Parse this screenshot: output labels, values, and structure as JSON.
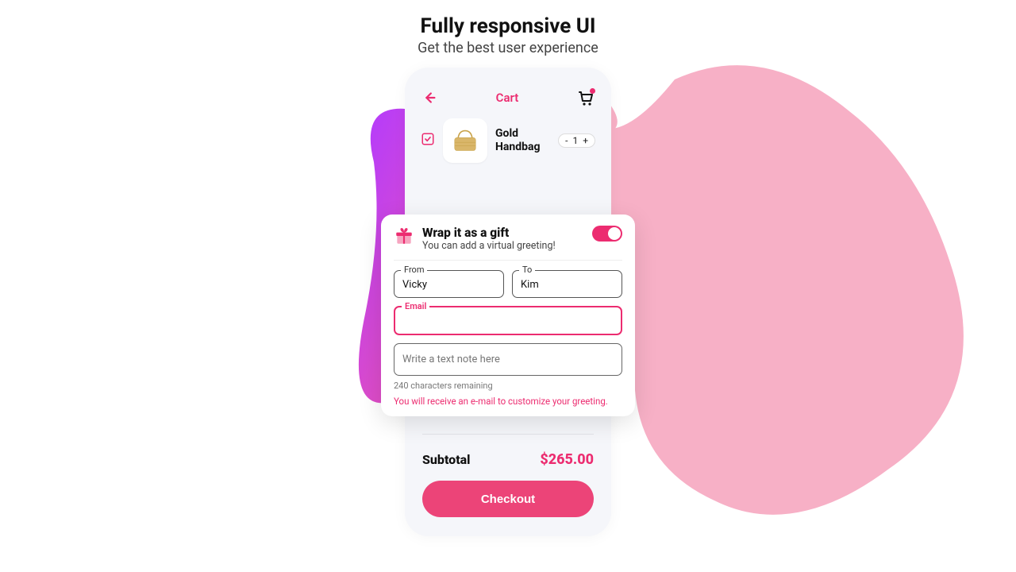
{
  "headline": {
    "title": "Fully responsive UI",
    "subtitle": "Get the best user experience"
  },
  "appbar": {
    "title": "Cart"
  },
  "item": {
    "name_line1": "Gold",
    "name_line2": "Handbag",
    "qty_minus": "-",
    "qty_value": "1",
    "qty_plus": "+"
  },
  "gift": {
    "title": "Wrap it as a gift",
    "subtitle": "You can add a virtual greeting!",
    "from_label": "From",
    "from_value": "Vicky",
    "to_label": "To",
    "to_value": "Kim",
    "email_label": "Email",
    "email_value": "",
    "note_placeholder": "Write a text note here",
    "remaining": "240 characters remaining",
    "email_msg": "You will receive an e-mail to customize your greeting.",
    "toggle_on": true
  },
  "totals": {
    "subtotal_label": "Subtotal",
    "subtotal_value": "$265.00"
  },
  "actions": {
    "checkout": "Checkout"
  },
  "colors": {
    "accent": "#ec2c70"
  }
}
